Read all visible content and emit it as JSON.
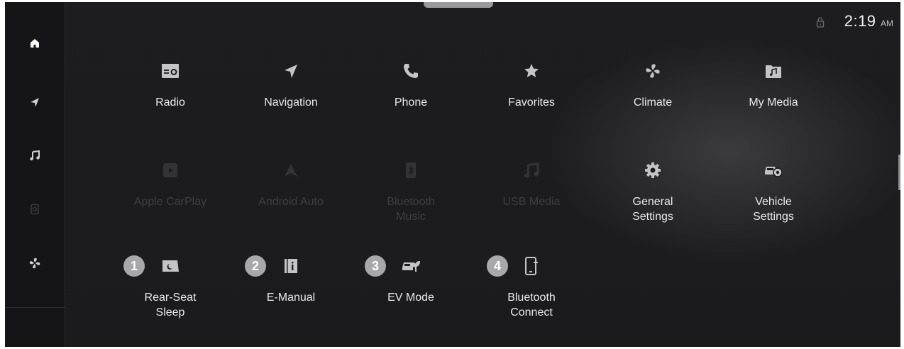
{
  "status": {
    "time": "2:19",
    "ampm": "AM",
    "lock_icon": "lock-icon"
  },
  "sidebar": {
    "items": [
      {
        "icon": "home-icon",
        "active": true
      },
      {
        "icon": "navigation-arrow-icon"
      },
      {
        "icon": "music-note-icon"
      },
      {
        "icon": "phone-projection-icon",
        "disabled": true
      },
      {
        "icon": "fan-icon"
      }
    ]
  },
  "apps": {
    "row1": [
      {
        "label": "Radio",
        "icon": "radio-icon"
      },
      {
        "label": "Navigation",
        "icon": "navigation-arrow-icon"
      },
      {
        "label": "Phone",
        "icon": "phone-icon"
      },
      {
        "label": "Favorites",
        "icon": "star-icon"
      },
      {
        "label": "Climate",
        "icon": "fan-icon"
      },
      {
        "label": "My Media",
        "icon": "music-folder-icon"
      }
    ],
    "row2": [
      {
        "label": "Apple CarPlay",
        "icon": "carplay-icon",
        "disabled": true
      },
      {
        "label": "Android Auto",
        "icon": "android-auto-icon",
        "disabled": true
      },
      {
        "label": "Bluetooth\nMusic",
        "icon": "bluetooth-music-icon",
        "disabled": true
      },
      {
        "label": "USB Media",
        "icon": "usb-music-icon",
        "disabled": true
      },
      {
        "label": "General\nSettings",
        "icon": "gear-icon"
      },
      {
        "label": "Vehicle\nSettings",
        "icon": "car-gear-icon"
      }
    ],
    "row3": [
      {
        "badge": "1",
        "label": "Rear-Seat\nSleep",
        "icon": "rear-seat-sleep-icon"
      },
      {
        "badge": "2",
        "label": "E-Manual",
        "icon": "manual-book-icon"
      },
      {
        "badge": "3",
        "label": "EV Mode",
        "icon": "ev-mode-icon"
      },
      {
        "badge": "4",
        "label": "Bluetooth\nConnect",
        "icon": "phone-add-icon"
      }
    ]
  },
  "colors": {
    "background": "#1c1c1e",
    "icon": "#c4c4c6",
    "label": "#e9e9e9",
    "disabled": "#3e3e40",
    "badge": "#a8a8aa"
  }
}
